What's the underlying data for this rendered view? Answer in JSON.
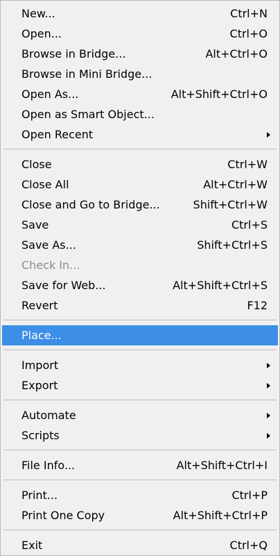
{
  "menu": {
    "groups": [
      [
        {
          "label": "New...",
          "shortcut": "Ctrl+N"
        },
        {
          "label": "Open...",
          "shortcut": "Ctrl+O"
        },
        {
          "label": "Browse in Bridge...",
          "shortcut": "Alt+Ctrl+O"
        },
        {
          "label": "Browse in Mini Bridge...",
          "shortcut": ""
        },
        {
          "label": "Open As...",
          "shortcut": "Alt+Shift+Ctrl+O"
        },
        {
          "label": "Open as Smart Object...",
          "shortcut": ""
        },
        {
          "label": "Open Recent",
          "shortcut": "",
          "submenu": true
        }
      ],
      [
        {
          "label": "Close",
          "shortcut": "Ctrl+W"
        },
        {
          "label": "Close All",
          "shortcut": "Alt+Ctrl+W"
        },
        {
          "label": "Close and Go to Bridge...",
          "shortcut": "Shift+Ctrl+W"
        },
        {
          "label": "Save",
          "shortcut": "Ctrl+S"
        },
        {
          "label": "Save As...",
          "shortcut": "Shift+Ctrl+S"
        },
        {
          "label": "Check In...",
          "shortcut": "",
          "disabled": true
        },
        {
          "label": "Save for Web...",
          "shortcut": "Alt+Shift+Ctrl+S"
        },
        {
          "label": "Revert",
          "shortcut": "F12"
        }
      ],
      [
        {
          "label": "Place...",
          "shortcut": "",
          "highlighted": true
        }
      ],
      [
        {
          "label": "Import",
          "shortcut": "",
          "submenu": true
        },
        {
          "label": "Export",
          "shortcut": "",
          "submenu": true
        }
      ],
      [
        {
          "label": "Automate",
          "shortcut": "",
          "submenu": true
        },
        {
          "label": "Scripts",
          "shortcut": "",
          "submenu": true
        }
      ],
      [
        {
          "label": "File Info...",
          "shortcut": "Alt+Shift+Ctrl+I"
        }
      ],
      [
        {
          "label": "Print...",
          "shortcut": "Ctrl+P"
        },
        {
          "label": "Print One Copy",
          "shortcut": "Alt+Shift+Ctrl+P"
        }
      ],
      [
        {
          "label": "Exit",
          "shortcut": "Ctrl+Q"
        }
      ]
    ],
    "colors": {
      "background": "#f0f0f0",
      "highlight": "#3d8ee6",
      "separator": "#bdbdbd",
      "disabled_text": "#8a8a8a"
    }
  }
}
